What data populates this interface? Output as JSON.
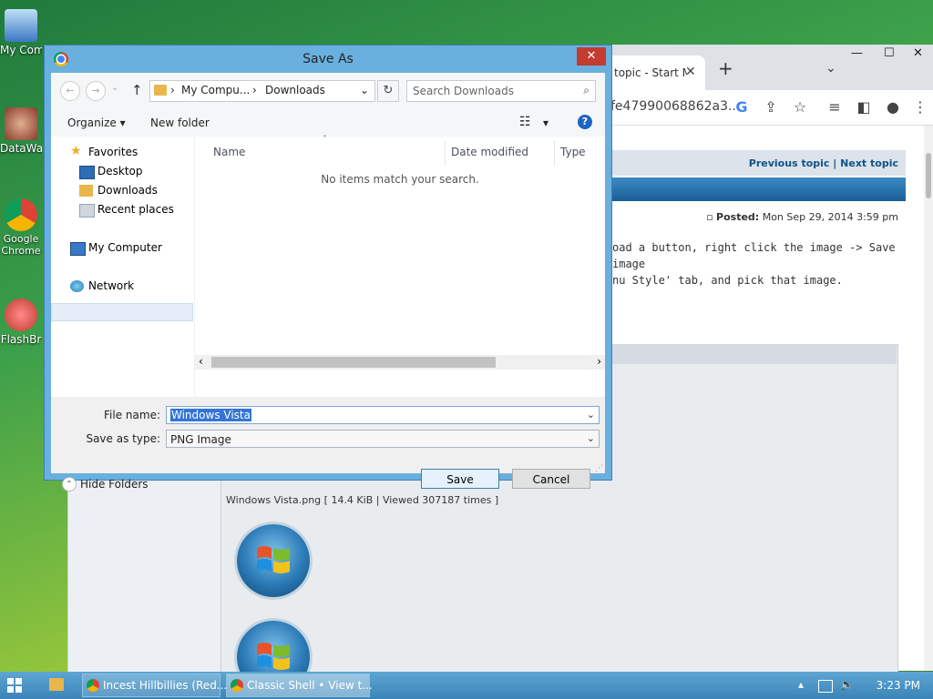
{
  "desktop": {
    "icons": [
      {
        "label": "My Computer",
        "color": "#3b78c4"
      },
      {
        "label": "DataWa",
        "color": "#8a3a2a"
      },
      {
        "label": "Google Chrome",
        "color": "#d93025"
      },
      {
        "label": "FlashBr",
        "color": "#c0392b"
      }
    ]
  },
  "browser": {
    "tab_title": "topic - Start M",
    "tab_close": "✕",
    "new_tab": "+",
    "tab_menu": "⌄",
    "url_fragment": "fe47990068862a3...",
    "window_controls": {
      "minimize": "—",
      "maximize": "☐",
      "close": "✕"
    },
    "topic_nav": {
      "previous": "Previous topic",
      "separator": "|",
      "next": "Next topic"
    },
    "posted_label": "Posted:",
    "posted_date": "Mon Sep 29, 2014 3:59 pm",
    "post_line1": "oad a button, right click the image -> Save image",
    "post_line2": "nu Style' tab, and pick that image.",
    "attachment_caption": "Windows Vista.png [ 14.4 KiB | Viewed 307187 times ]"
  },
  "dialog": {
    "title": "Save As",
    "close": "✕",
    "back": "←",
    "forward": "→",
    "history": "⌄",
    "up": "↑",
    "address_segments": [
      "My Compu...",
      "Downloads"
    ],
    "address_sep": "›",
    "address_dropdown": "⌄",
    "refresh": "↻",
    "search_placeholder": "Search Downloads",
    "search_icon": "⌕",
    "organize": "Organize",
    "organize_chevron": "▾",
    "new_folder": "New folder",
    "view_icon": "☷",
    "view_chevron": "▾",
    "help": "?",
    "nav": {
      "favorites": "Favorites",
      "desktop": "Desktop",
      "downloads": "Downloads",
      "recent_places": "Recent places",
      "my_computer": "My Computer",
      "network": "Network"
    },
    "columns": {
      "name": "Name",
      "date_modified": "Date modified",
      "type": "Type"
    },
    "sort_indicator": "˄",
    "empty_message": "No items match your search.",
    "scroll_left": "‹",
    "scroll_right": "›",
    "file_name_label": "File name:",
    "file_name_value": "Windows Vista",
    "save_type_label": "Save as type:",
    "save_type_value": "PNG Image",
    "field_chevron": "⌄",
    "hide_folders_chevron": "⌃",
    "hide_folders": "Hide Folders",
    "save": "Save",
    "cancel": "Cancel"
  },
  "taskbar": {
    "tasks": [
      {
        "title": "Incest Hillbillies (Red..."
      },
      {
        "title": "Classic Shell • View t..."
      }
    ],
    "tray_up": "▴",
    "tray_speaker": "🔈",
    "clock": "3:23 PM"
  }
}
